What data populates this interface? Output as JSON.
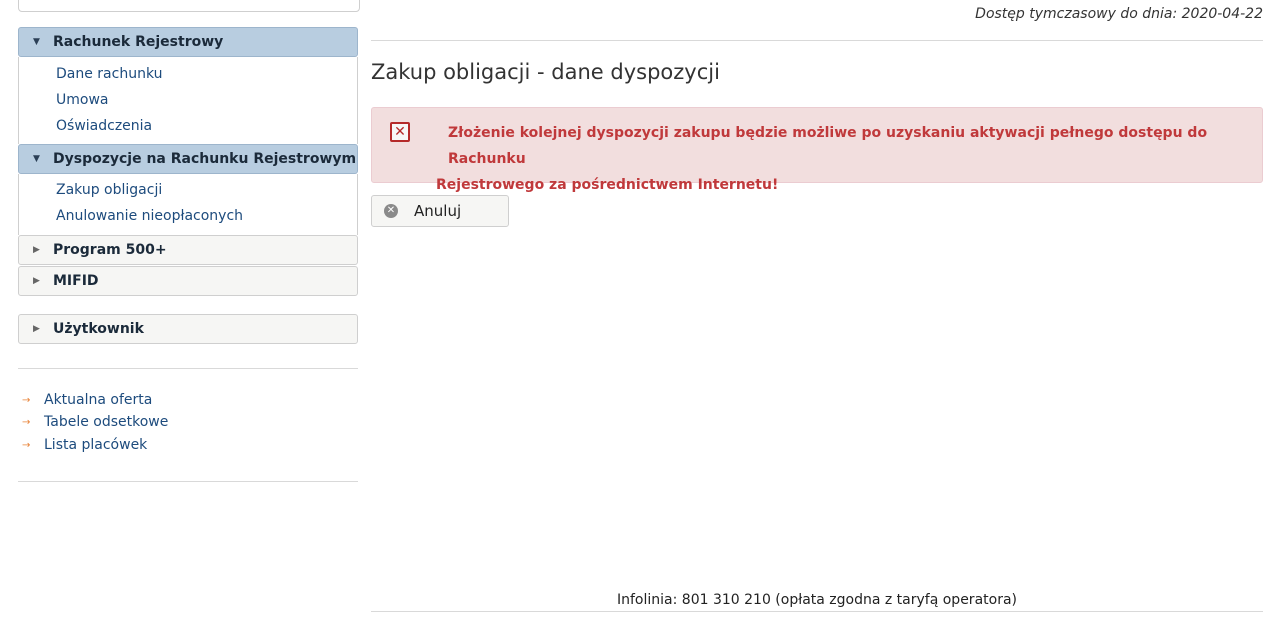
{
  "header": {
    "access_note": "Dostęp tymczasowy do dnia: 2020-04-22"
  },
  "sidebar": {
    "sections": [
      {
        "label": "Rachunek Rejestrowy",
        "expanded": true,
        "items": [
          "Dane rachunku",
          "Umowa",
          "Oświadczenia"
        ]
      },
      {
        "label": "Dyspozycje na Rachunku Rejestrowym",
        "expanded": true,
        "items": [
          "Zakup obligacji",
          "Anulowanie nieopłaconych"
        ]
      },
      {
        "label": "Program 500+",
        "expanded": false
      },
      {
        "label": "MIFID",
        "expanded": false
      },
      {
        "label": "Użytkownik",
        "expanded": false
      }
    ],
    "links": [
      "Aktualna oferta",
      "Tabele odsetkowe",
      "Lista placówek"
    ]
  },
  "main": {
    "title": "Zakup obligacji - dane dyspozycji",
    "alert": {
      "line1": "Złożenie kolejnej dyspozycji zakupu będzie możliwe po uzyskaniu aktywacji pełnego dostępu do Rachunku",
      "line2": "Rejestrowego za pośrednictwem Internetu!",
      "icon": "error-x-icon"
    },
    "cancel_label": "Anuluj"
  },
  "footer": {
    "infolinia": "Infolinia: 801 310 210 (opłata zgodna z taryfą operatora)"
  },
  "colors": {
    "accent_header": "#b8cde0",
    "alert_bg": "#f2dede",
    "alert_text": "#c0393b",
    "link": "#1d4b7d",
    "bullet_arrow": "#e8843a"
  }
}
